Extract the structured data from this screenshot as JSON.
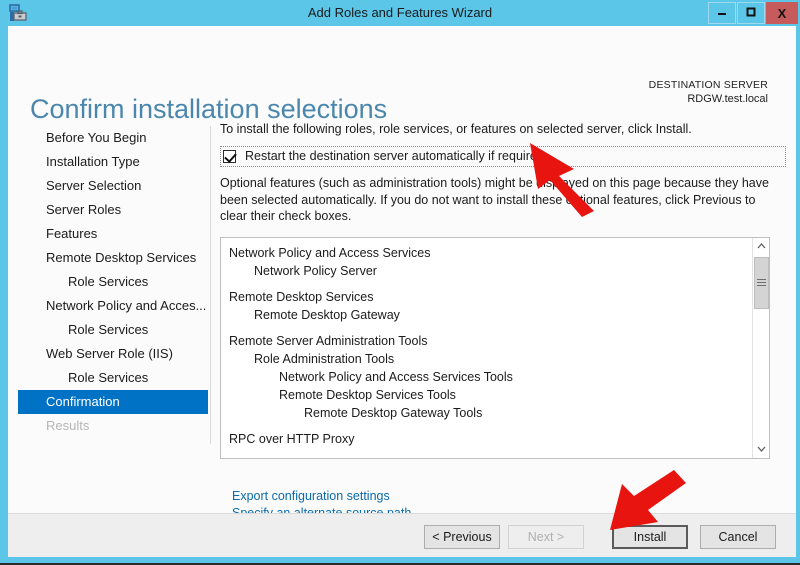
{
  "window": {
    "title": "Add Roles and Features Wizard",
    "app_icon": "server-manager-icon",
    "controls": {
      "minimize": "–",
      "maximize": "□",
      "close": "X"
    }
  },
  "header": {
    "page_title": "Confirm installation selections",
    "destination_label": "DESTINATION SERVER",
    "destination_server": "RDGW.test.local"
  },
  "sidebar": {
    "items": [
      {
        "label": "Before You Begin",
        "level": 0,
        "state": "normal"
      },
      {
        "label": "Installation Type",
        "level": 0,
        "state": "normal"
      },
      {
        "label": "Server Selection",
        "level": 0,
        "state": "normal"
      },
      {
        "label": "Server Roles",
        "level": 0,
        "state": "normal"
      },
      {
        "label": "Features",
        "level": 0,
        "state": "normal"
      },
      {
        "label": "Remote Desktop Services",
        "level": 0,
        "state": "normal"
      },
      {
        "label": "Role Services",
        "level": 1,
        "state": "normal"
      },
      {
        "label": "Network Policy and Acces...",
        "level": 0,
        "state": "normal"
      },
      {
        "label": "Role Services",
        "level": 1,
        "state": "normal"
      },
      {
        "label": "Web Server Role (IIS)",
        "level": 0,
        "state": "normal"
      },
      {
        "label": "Role Services",
        "level": 1,
        "state": "normal"
      },
      {
        "label": "Confirmation",
        "level": 0,
        "state": "active"
      },
      {
        "label": "Results",
        "level": 0,
        "state": "disabled"
      }
    ]
  },
  "main": {
    "intro": "To install the following roles, role services, or features on selected server, click Install.",
    "restart_checkbox": {
      "label": "Restart the destination server automatically if required",
      "checked": true,
      "focused": true
    },
    "optional_text": "Optional features (such as administration tools) might be displayed on this page because they have been selected automatically. If you do not want to install these optional features, click Previous to clear their check boxes.",
    "selection_list": [
      {
        "text": "Network Policy and Access Services",
        "indent": 0,
        "gap_above": false
      },
      {
        "text": "Network Policy Server",
        "indent": 1,
        "gap_above": false
      },
      {
        "text": "Remote Desktop Services",
        "indent": 0,
        "gap_above": true
      },
      {
        "text": "Remote Desktop Gateway",
        "indent": 1,
        "gap_above": false
      },
      {
        "text": "Remote Server Administration Tools",
        "indent": 0,
        "gap_above": true
      },
      {
        "text": "Role Administration Tools",
        "indent": 1,
        "gap_above": false
      },
      {
        "text": "Network Policy and Access Services Tools",
        "indent": 2,
        "gap_above": false
      },
      {
        "text": "Remote Desktop Services Tools",
        "indent": 2,
        "gap_above": false
      },
      {
        "text": "Remote Desktop Gateway Tools",
        "indent": 3,
        "gap_above": false
      },
      {
        "text": "RPC over HTTP Proxy",
        "indent": 0,
        "gap_above": true
      }
    ],
    "scrollbar": {
      "up_arrow": "^",
      "down_arrow": "v"
    },
    "links": [
      "Export configuration settings",
      "Specify an alternate source path"
    ]
  },
  "footer": {
    "previous": "< Previous",
    "next": "Next >",
    "install": "Install",
    "cancel": "Cancel",
    "next_disabled": true,
    "install_focused": true
  },
  "annotations": {
    "arrow_1_target": "restart-checkbox",
    "arrow_2_target": "install-button",
    "arrow_color": "#e8140f"
  },
  "colors": {
    "accent_blue": "#5bc6e8",
    "selection_blue": "#0072c6",
    "title_blue": "#4b87ad",
    "link_blue": "#0b6bab",
    "close_red": "#c75b5b",
    "arrow_red": "#e8140f"
  }
}
